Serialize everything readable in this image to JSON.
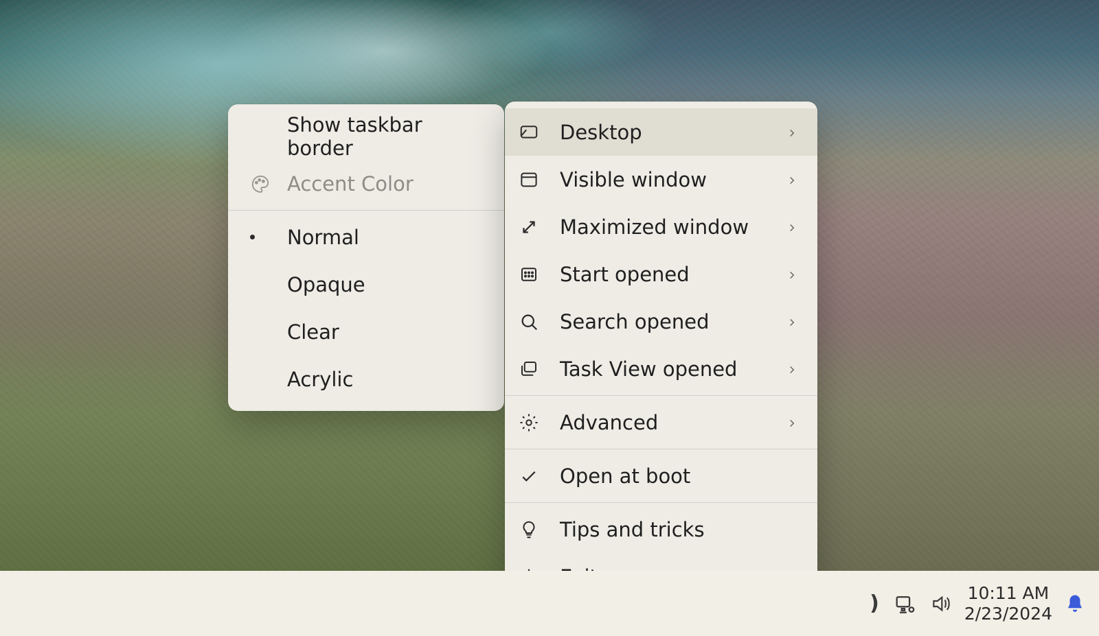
{
  "taskbar": {
    "time": "10:11 AM",
    "date": "2/23/2024"
  },
  "main_menu": {
    "items": [
      {
        "key": "desktop",
        "label": "Desktop",
        "icon": "desktop-icon",
        "chevron": true,
        "hovered": true
      },
      {
        "key": "visible-window",
        "label": "Visible window",
        "icon": "window-icon",
        "chevron": true
      },
      {
        "key": "maximized-window",
        "label": "Maximized window",
        "icon": "expand-icon",
        "chevron": true
      },
      {
        "key": "start-opened",
        "label": "Start opened",
        "icon": "grid-icon",
        "chevron": true
      },
      {
        "key": "search-opened",
        "label": "Search opened",
        "icon": "search-icon",
        "chevron": true
      },
      {
        "key": "taskview-opened",
        "label": "Task View opened",
        "icon": "taskview-icon",
        "chevron": true
      },
      {
        "key": "divider1"
      },
      {
        "key": "advanced",
        "label": "Advanced",
        "icon": "gear-icon",
        "chevron": true
      },
      {
        "key": "divider2"
      },
      {
        "key": "open-at-boot",
        "label": "Open at boot",
        "icon": "check-icon",
        "chevron": false
      },
      {
        "key": "divider3"
      },
      {
        "key": "tips-and-tricks",
        "label": "Tips and tricks",
        "icon": "bulb-icon",
        "chevron": false
      },
      {
        "key": "exit",
        "label": "Exit",
        "icon": "power-icon",
        "chevron": false
      }
    ]
  },
  "sub_menu": {
    "items": [
      {
        "key": "show-taskbar-border",
        "label": "Show taskbar border",
        "bullet": false
      },
      {
        "key": "accent-color",
        "label": "Accent Color",
        "icon": "palette-icon",
        "disabled": true
      },
      {
        "key": "divider"
      },
      {
        "key": "normal",
        "label": "Normal",
        "bullet": true
      },
      {
        "key": "opaque",
        "label": "Opaque",
        "bullet": false
      },
      {
        "key": "clear",
        "label": "Clear",
        "bullet": false
      },
      {
        "key": "acrylic",
        "label": "Acrylic",
        "bullet": false
      }
    ]
  }
}
